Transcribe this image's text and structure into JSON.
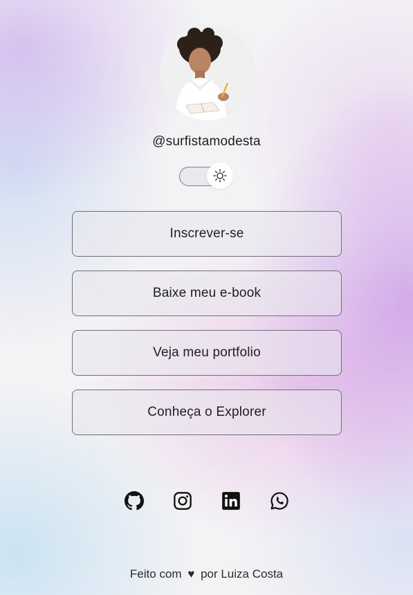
{
  "profile": {
    "username": "@surfistamodesta"
  },
  "theme_toggle": {
    "icon": "sun-icon",
    "state": "light"
  },
  "links": [
    {
      "label": "Inscrever-se"
    },
    {
      "label": "Baixe meu e-book"
    },
    {
      "label": "Veja meu portfolio"
    },
    {
      "label": "Conheça o Explorer"
    }
  ],
  "social": [
    {
      "icon": "github-icon"
    },
    {
      "icon": "instagram-icon"
    },
    {
      "icon": "linkedin-icon"
    },
    {
      "icon": "whatsapp-icon"
    }
  ],
  "footer": {
    "prefix": "Feito com",
    "heart": "♥",
    "suffix": "por Luiza Costa"
  },
  "colors": {
    "text": "#1e1e1e",
    "button_border": "#6f6f78",
    "accent_purple": "#c896e6"
  }
}
